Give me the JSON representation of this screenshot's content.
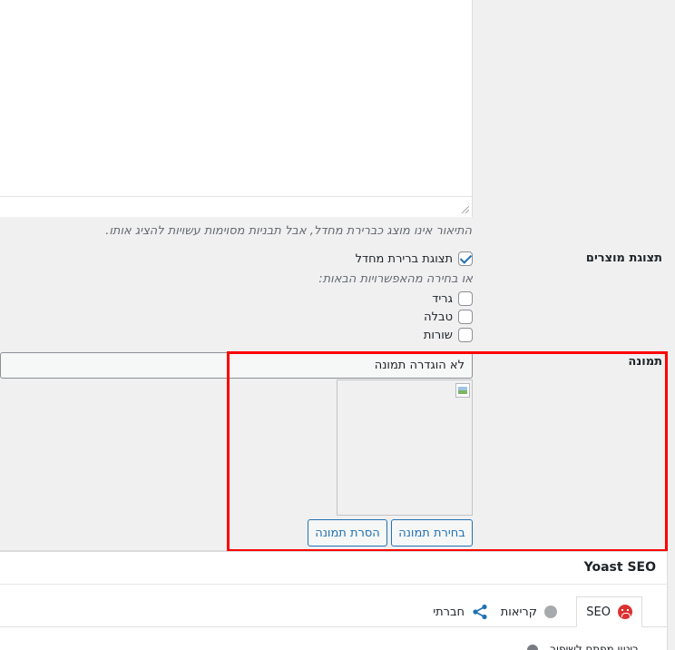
{
  "description": {
    "hint": "התיאור אינו מוצג כברירת מחדל, אבל תבניות מסוימות עשויות להציג אותו."
  },
  "product_display": {
    "label": "תצוגת מוצרים",
    "default_option": {
      "label": "תצוגת ברירת מחדל",
      "checked": true
    },
    "or_hint": "או בחירה מהאפשרויות הבאות:",
    "options": [
      {
        "label": "גריד",
        "checked": false
      },
      {
        "label": "טבלה",
        "checked": false
      },
      {
        "label": "שורות",
        "checked": false
      }
    ]
  },
  "image": {
    "label": "תמונה",
    "select_value": "לא הוגדרה תמונה",
    "choose_button": "בחירת תמונה",
    "remove_button": "הסרת תמונה"
  },
  "yoast": {
    "title": "Yoast SEO",
    "tabs": [
      {
        "label": "SEO",
        "icon": "sad-face-icon",
        "active": true
      },
      {
        "label": "קריאות",
        "icon": "grey-dot-icon",
        "active": false
      },
      {
        "label": "חברתי",
        "icon": "share-icon",
        "active": false
      }
    ],
    "focus_keyphrase_partial": "ביטוי מפתח לשיפור"
  },
  "colors": {
    "accent": "#2271b1",
    "highlight": "#ff0000",
    "error": "#dc3232"
  }
}
